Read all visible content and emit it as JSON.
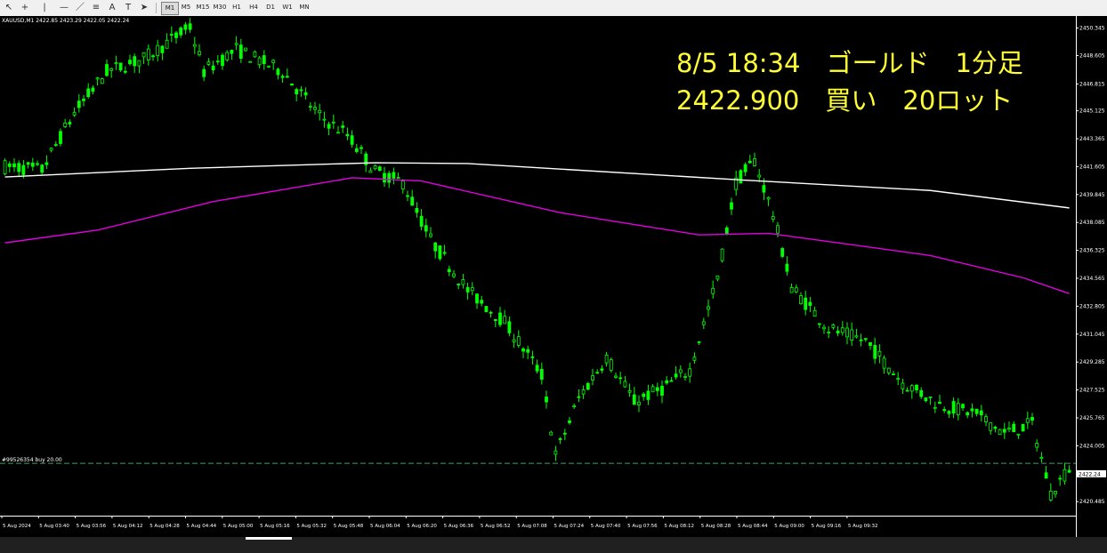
{
  "toolbar": {
    "tools": [
      "cursor-icon",
      "crosshair-icon",
      "vertical-line-icon",
      "horizontal-line-icon",
      "trendline-icon",
      "fibonacci-icon",
      "text-icon",
      "label-icon",
      "arrow-icon"
    ],
    "timeframes": [
      "M1",
      "M5",
      "M15",
      "M30",
      "H1",
      "H4",
      "D1",
      "W1",
      "MN"
    ],
    "active_timeframe": "M1"
  },
  "chart_data": {
    "type": "candlestick",
    "symbol": "XAUUSD",
    "ohlc_header": "XAUUSD,M1 2422.85 2423.29 2422.05 2422.24",
    "annotation": [
      "8/5 18:34　ゴールド　1分足",
      "2422.900　買い　20ロット"
    ],
    "order_label": "#99526354 buy 20.00",
    "order_price": 2422.9,
    "current_price": 2422.24,
    "ylim": [
      2419.6,
      2451.1
    ],
    "y_ticks": [
      {
        "value": 2450.345,
        "label": "2450.345"
      },
      {
        "value": 2448.605,
        "label": "2448.605"
      },
      {
        "value": 2446.815,
        "label": "2446.815"
      },
      {
        "value": 2445.125,
        "label": "2445.125"
      },
      {
        "value": 2443.365,
        "label": "2443.365"
      },
      {
        "value": 2441.605,
        "label": "2441.605"
      },
      {
        "value": 2439.845,
        "label": "2439.845"
      },
      {
        "value": 2438.085,
        "label": "2438.085"
      },
      {
        "value": 2436.325,
        "label": "2436.325"
      },
      {
        "value": 2434.565,
        "label": "2434.565"
      },
      {
        "value": 2432.805,
        "label": "2432.805"
      },
      {
        "value": 2431.045,
        "label": "2431.045"
      },
      {
        "value": 2429.285,
        "label": "2429.285"
      },
      {
        "value": 2427.525,
        "label": "2427.525"
      },
      {
        "value": 2425.765,
        "label": "2425.765"
      },
      {
        "value": 2424.005,
        "label": "2424.005"
      },
      {
        "value": 2422.245,
        "label": "2422.245"
      },
      {
        "value": 2420.485,
        "label": "2420.485"
      }
    ],
    "x_labels": [
      "5 Aug 2024",
      "5 Aug 03:40",
      "5 Aug 03:56",
      "5 Aug 04:12",
      "5 Aug 04:28",
      "5 Aug 04:44",
      "5 Aug 05:00",
      "5 Aug 05:16",
      "5 Aug 05:32",
      "5 Aug 05:48",
      "5 Aug 06:04",
      "5 Aug 06:20",
      "5 Aug 06:36",
      "5 Aug 06:52",
      "5 Aug 07:08",
      "5 Aug 07:24",
      "5 Aug 07:40",
      "5 Aug 07:56",
      "5 Aug 08:12",
      "5 Aug 08:28",
      "5 Aug 08:44",
      "5 Aug 09:00",
      "5 Aug 09:16",
      "5 Aug 09:32"
    ],
    "n_bars": 231,
    "price_path": [
      {
        "bar": 0,
        "price": 2441.6
      },
      {
        "bar": 8,
        "price": 2441.4
      },
      {
        "bar": 15,
        "price": 2445.0
      },
      {
        "bar": 22,
        "price": 2447.6
      },
      {
        "bar": 30,
        "price": 2448.4
      },
      {
        "bar": 36,
        "price": 2449.6
      },
      {
        "bar": 40,
        "price": 2450.4
      },
      {
        "bar": 43,
        "price": 2447.6
      },
      {
        "bar": 50,
        "price": 2449.0
      },
      {
        "bar": 60,
        "price": 2447.6
      },
      {
        "bar": 68,
        "price": 2444.8
      },
      {
        "bar": 74,
        "price": 2443.6
      },
      {
        "bar": 80,
        "price": 2441.3
      },
      {
        "bar": 86,
        "price": 2440.6
      },
      {
        "bar": 92,
        "price": 2437.0
      },
      {
        "bar": 100,
        "price": 2433.8
      },
      {
        "bar": 108,
        "price": 2431.8
      },
      {
        "bar": 116,
        "price": 2428.5
      },
      {
        "bar": 119,
        "price": 2423.4
      },
      {
        "bar": 124,
        "price": 2427.0
      },
      {
        "bar": 130,
        "price": 2429.6
      },
      {
        "bar": 136,
        "price": 2426.8
      },
      {
        "bar": 142,
        "price": 2427.6
      },
      {
        "bar": 148,
        "price": 2428.8
      },
      {
        "bar": 154,
        "price": 2434.6
      },
      {
        "bar": 158,
        "price": 2440.6
      },
      {
        "bar": 162,
        "price": 2442.0
      },
      {
        "bar": 166,
        "price": 2438.6
      },
      {
        "bar": 170,
        "price": 2434.0
      },
      {
        "bar": 178,
        "price": 2431.4
      },
      {
        "bar": 186,
        "price": 2430.6
      },
      {
        "bar": 194,
        "price": 2428.0
      },
      {
        "bar": 202,
        "price": 2426.6
      },
      {
        "bar": 210,
        "price": 2426.0
      },
      {
        "bar": 216,
        "price": 2424.8
      },
      {
        "bar": 222,
        "price": 2425.4
      },
      {
        "bar": 226,
        "price": 2421.0
      },
      {
        "bar": 230,
        "price": 2422.6
      },
      {
        "bar": 234,
        "price": 2424.8
      },
      {
        "bar": 237,
        "price": 2422.2
      },
      {
        "bar": 240,
        "price": 2422.2
      }
    ],
    "series": [
      {
        "type": "line",
        "color": "#ffffff",
        "points": [
          {
            "bar": 0,
            "price": 2440.95
          },
          {
            "bar": 40,
            "price": 2441.5
          },
          {
            "bar": 80,
            "price": 2441.85
          },
          {
            "bar": 100,
            "price": 2441.8
          },
          {
            "bar": 160,
            "price": 2440.75
          },
          {
            "bar": 200,
            "price": 2440.1
          },
          {
            "bar": 230,
            "price": 2439.0
          }
        ]
      },
      {
        "type": "line",
        "color": "#e000e0",
        "points": [
          {
            "bar": 0,
            "price": 2436.8
          },
          {
            "bar": 20,
            "price": 2437.6
          },
          {
            "bar": 45,
            "price": 2439.4
          },
          {
            "bar": 75,
            "price": 2440.9
          },
          {
            "bar": 90,
            "price": 2440.7
          },
          {
            "bar": 120,
            "price": 2438.7
          },
          {
            "bar": 150,
            "price": 2437.3
          },
          {
            "bar": 165,
            "price": 2437.4
          },
          {
            "bar": 200,
            "price": 2436.0
          },
          {
            "bar": 220,
            "price": 2434.6
          },
          {
            "bar": 230,
            "price": 2433.6
          }
        ]
      }
    ],
    "colors": {
      "background": "#000000",
      "candle": "#00ff00",
      "annotation": "#ffff33",
      "axis": "#ffffff",
      "order_line": "#4a9a6a"
    }
  }
}
